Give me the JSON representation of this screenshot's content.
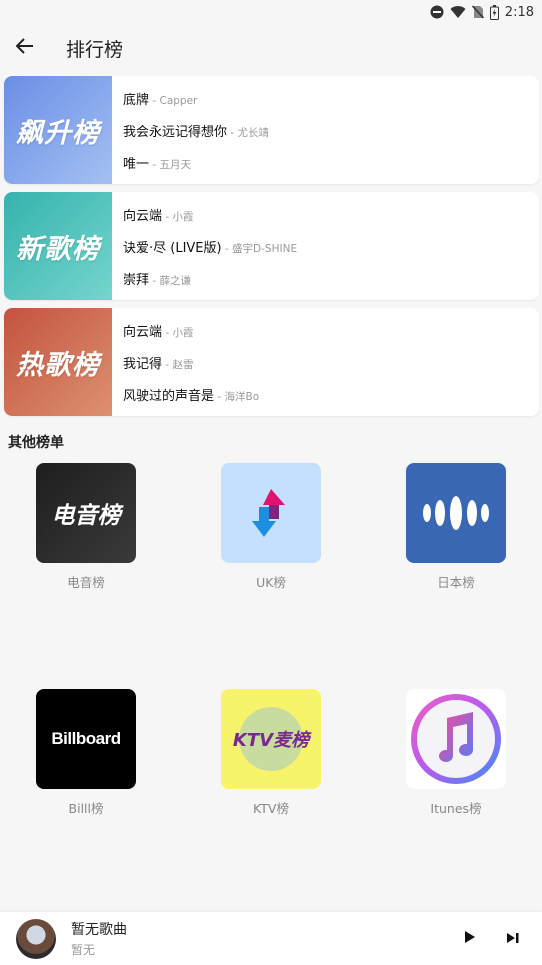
{
  "status_bar": {
    "time": "2:18"
  },
  "app_bar": {
    "title": "排行榜"
  },
  "featured_charts": [
    {
      "cover_text": "飙升榜",
      "gradient": [
        "#6a8ee6",
        "#9ab8ef"
      ],
      "songs": [
        {
          "title": "底牌",
          "artist": "Capper"
        },
        {
          "title": "我会永远记得想你",
          "artist": "尤长靖"
        },
        {
          "title": "唯一",
          "artist": "五月天"
        }
      ]
    },
    {
      "cover_text": "新歌榜",
      "gradient": [
        "#3eb8b1",
        "#6ed2cb"
      ],
      "songs": [
        {
          "title": "向云端",
          "artist": "小霞"
        },
        {
          "title": "诀爱·尽 (LIVE版)",
          "artist": "盛宇D-SHINE"
        },
        {
          "title": "崇拜",
          "artist": "薛之谦"
        }
      ]
    },
    {
      "cover_text": "热歌榜",
      "gradient": [
        "#c95d46",
        "#d98a6b"
      ],
      "songs": [
        {
          "title": "向云端",
          "artist": "小霞"
        },
        {
          "title": "我记得",
          "artist": "赵雷"
        },
        {
          "title": "风驶过的声音是",
          "artist": "海洋Bo"
        }
      ]
    }
  ],
  "other_section_title": "其他榜单",
  "other_charts": [
    {
      "label": "电音榜",
      "cover_text": "电音榜",
      "icon": "electronic-chart-icon"
    },
    {
      "label": "UK榜",
      "icon": "uk-arrows-icon"
    },
    {
      "label": "日本榜",
      "icon": "japan-waves-icon"
    },
    {
      "label": "Billl榜",
      "cover_text": "Billboard",
      "icon": "billboard-logo-icon"
    },
    {
      "label": "KTV榜",
      "cover_text": "KTV麦榜",
      "icon": "ktv-logo-icon"
    },
    {
      "label": "Itunes榜",
      "icon": "itunes-note-icon"
    }
  ],
  "player": {
    "title": "暂无歌曲",
    "subtitle": "暂无"
  },
  "colors": {
    "background": "#f6f6f6",
    "uk_bg": "#c5e0ff",
    "japan_bg": "#3a67b3",
    "ktv_bg": "#f7f46c"
  }
}
